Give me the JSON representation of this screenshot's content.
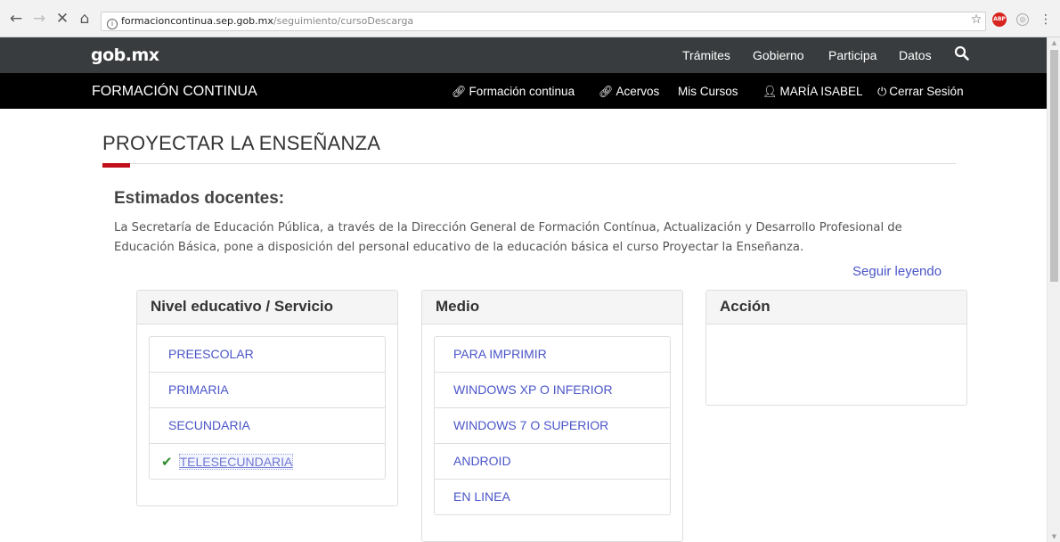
{
  "browser": {
    "url_host": "formacioncontinua.sep.gob.mx",
    "url_path": "/seguimiento/cursoDescarga"
  },
  "gob_header": {
    "logo": "gob.mx",
    "nav": [
      "Trámites",
      "Gobierno",
      "Participa",
      "Datos"
    ]
  },
  "site_header": {
    "title": "FORMACIÓN CONTINUA",
    "nav": {
      "formacion": "Formación continua",
      "acervos": "Acervos",
      "mis_cursos": "Mis Cursos",
      "user": "MARÍA ISABEL",
      "logout": "Cerrar Sesión"
    }
  },
  "main": {
    "page_title": "PROYECTAR LA ENSEÑANZA",
    "greeting": "Estimados docentes:",
    "intro": "La Secretaría de Educación Pública, a través de la Dirección General de Formación Contínua, Actualización y Desarrollo Profesional de Educación Básica, pone a disposición del personal educativo de la educación básica el curso Proyectar la Enseñanza.",
    "read_more": "Seguir leyendo"
  },
  "panels": {
    "nivel": {
      "title": "Nivel educativo / Servicio",
      "items": [
        "PREESCOLAR",
        "PRIMARIA",
        "SECUNDARIA",
        "TELESECUNDARIA"
      ],
      "selected": "TELESECUNDARIA"
    },
    "medio": {
      "title": "Medio",
      "items": [
        "PARA IMPRIMIR",
        "WINDOWS XP O INFERIOR",
        "WINDOWS 7 O SUPERIOR",
        "ANDROID",
        "EN LINEA"
      ]
    },
    "accion": {
      "title": "Acción"
    }
  },
  "colors": {
    "gob_bar": "#393c3e",
    "site_bar": "#000000",
    "accent": "#c40f1c",
    "link": "#4a55c8",
    "check": "#2e8b2e"
  },
  "icons": {
    "back": "arrow-left-icon",
    "forward": "arrow-right-icon",
    "stop": "close-icon",
    "home": "home-icon",
    "info": "info-icon",
    "bookmark": "star-icon",
    "adblock": "adblock-icon",
    "search": "search-icon",
    "link": "link-icon",
    "user": "user-icon",
    "power": "power-icon",
    "check": "checkmark-icon"
  }
}
